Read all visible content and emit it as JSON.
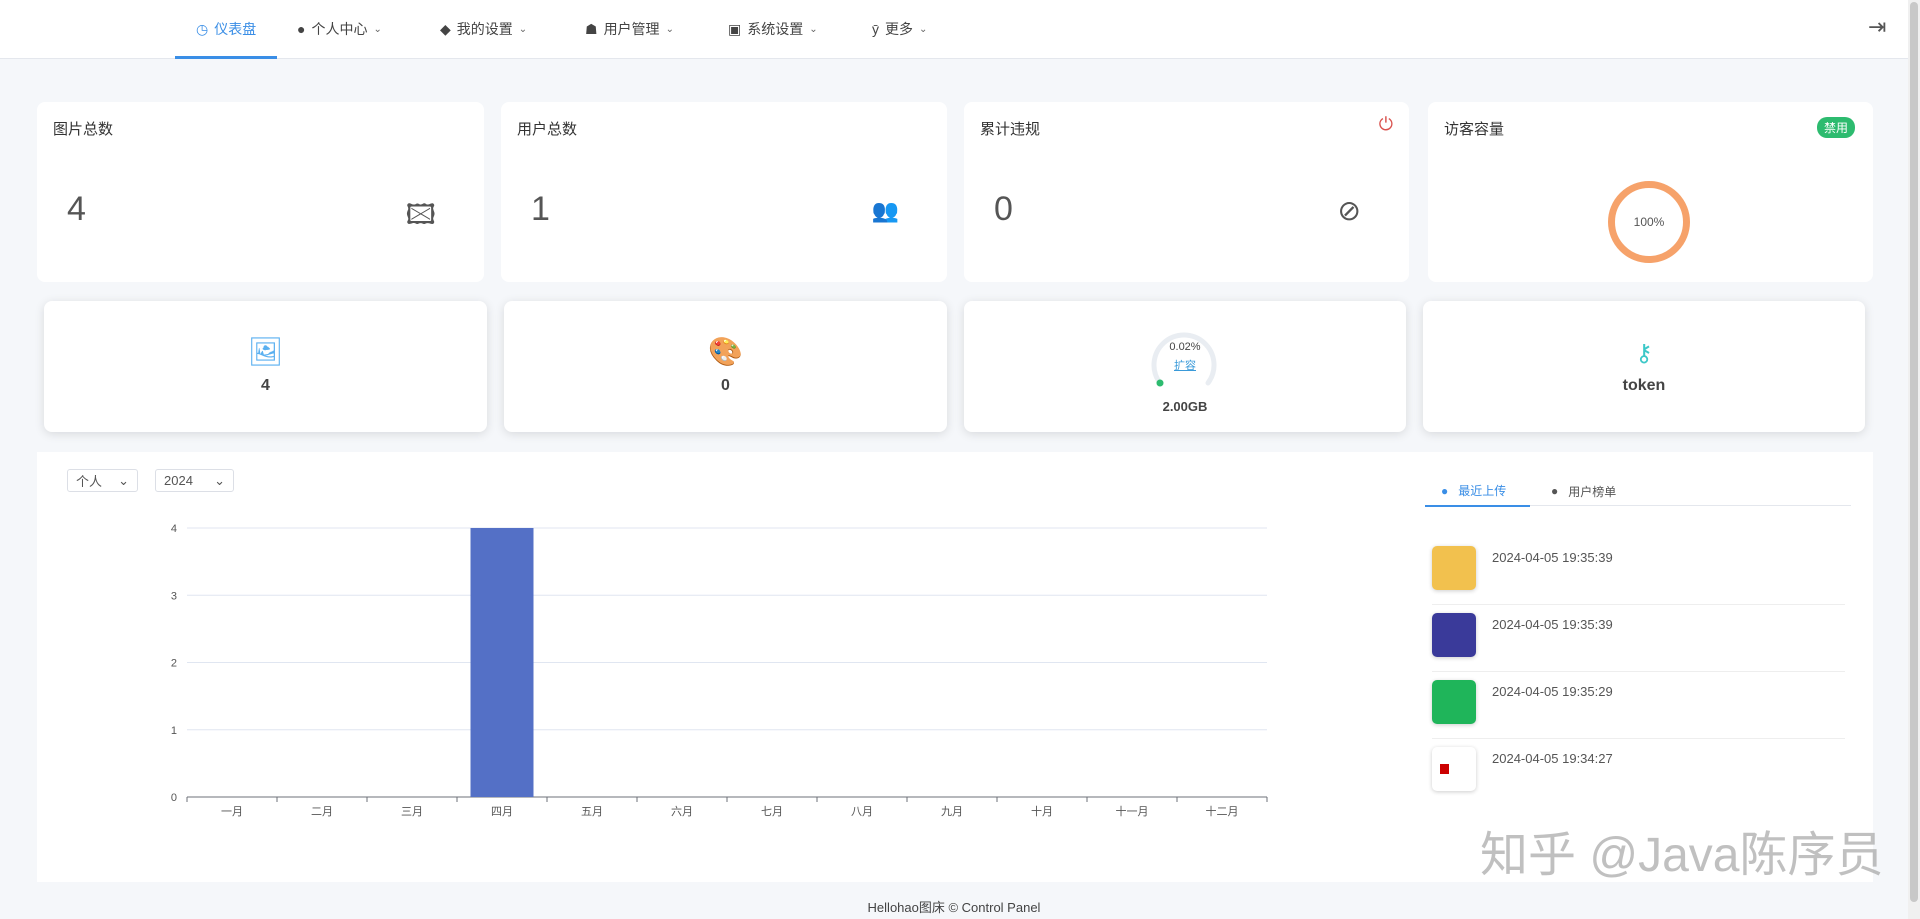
{
  "nav": {
    "items": [
      {
        "label": "仪表盘",
        "icon": "dashboard-icon"
      },
      {
        "label": "个人中心",
        "icon": "user-icon"
      },
      {
        "label": "我的设置",
        "icon": "paint-bucket-icon"
      },
      {
        "label": "用户管理",
        "icon": "users-icon"
      },
      {
        "label": "系统设置",
        "icon": "toggle-icon"
      },
      {
        "label": "更多",
        "icon": "fork-icon"
      }
    ]
  },
  "stats": [
    {
      "title": "图片总数",
      "value": "4"
    },
    {
      "title": "用户总数",
      "value": "1"
    },
    {
      "title": "累计违规",
      "value": "0"
    },
    {
      "title": "访客容量",
      "badge": "禁用",
      "percent": "100%"
    }
  ],
  "quick": [
    {
      "value": "4"
    },
    {
      "value": "0"
    },
    {
      "percent": "0.02%",
      "link": "扩容",
      "value": "2.00GB",
      "fraction": 0.0002
    },
    {
      "value": "token"
    }
  ],
  "filters": {
    "scope": "个人",
    "year": "2024"
  },
  "chart_data": {
    "type": "bar",
    "categories": [
      "一月",
      "二月",
      "三月",
      "四月",
      "五月",
      "六月",
      "七月",
      "八月",
      "九月",
      "十月",
      "十一月",
      "十二月"
    ],
    "values": [
      0,
      0,
      0,
      4,
      0,
      0,
      0,
      0,
      0,
      0,
      0,
      0
    ],
    "ylim": [
      0,
      4
    ],
    "yticks": [
      "0",
      "1",
      "2",
      "3",
      "4"
    ],
    "color": "#5470c6"
  },
  "recent": {
    "tabs": [
      "最近上传",
      "用户榜单"
    ],
    "items": [
      {
        "time": "2024-04-05 19:35:39",
        "color": "#f2c14e"
      },
      {
        "time": "2024-04-05 19:35:39",
        "color": "#3a3a9a"
      },
      {
        "time": "2024-04-05 19:35:29",
        "color": "#1fb55a"
      },
      {
        "time": "2024-04-05 19:34:27",
        "color": "#ffffff"
      }
    ]
  },
  "footer": "Hellohao图床 © Control Panel",
  "watermark": "知乎 @Java陈序员"
}
